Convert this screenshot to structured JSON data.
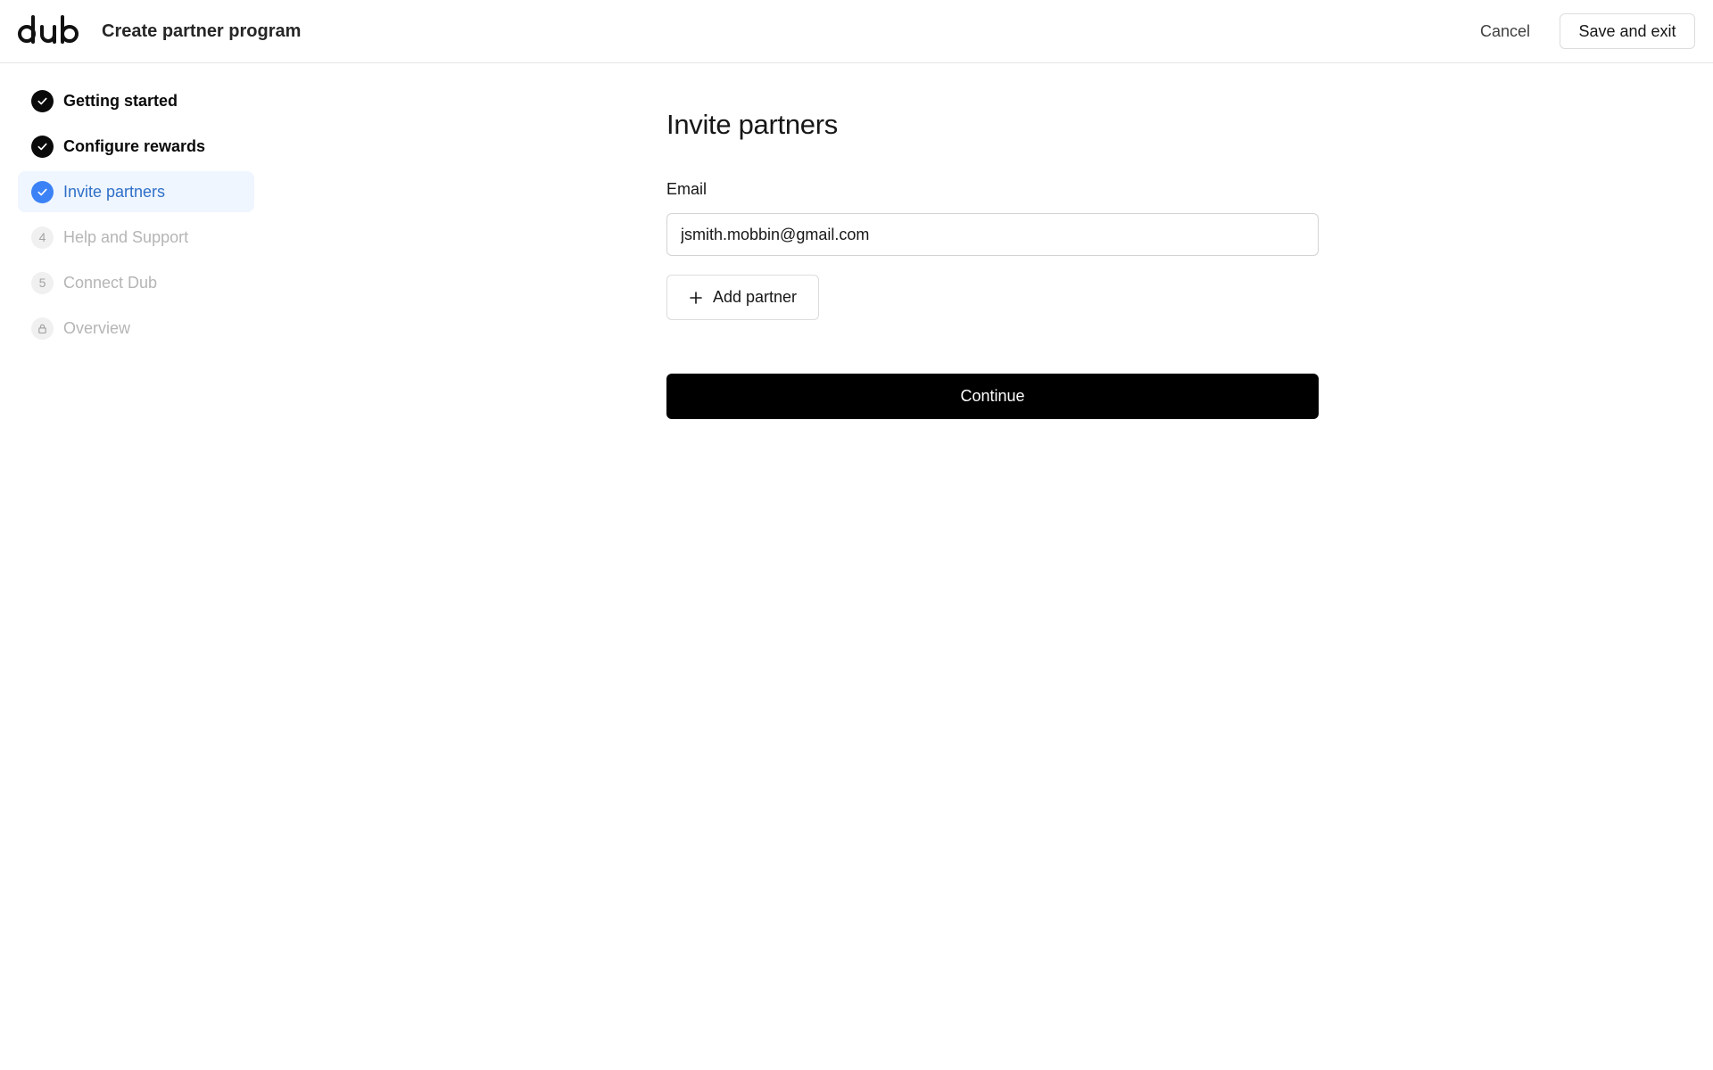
{
  "header": {
    "logo_text": "dub",
    "title": "Create partner program",
    "cancel_label": "Cancel",
    "save_label": "Save and exit"
  },
  "sidebar": {
    "steps": [
      {
        "label": "Getting started",
        "status": "completed",
        "icon": "check-icon"
      },
      {
        "label": "Configure rewards",
        "status": "completed",
        "icon": "check-icon"
      },
      {
        "label": "Invite partners",
        "status": "current",
        "icon": "check-icon"
      },
      {
        "label": "Help and Support",
        "status": "pending",
        "number": "4"
      },
      {
        "label": "Connect Dub",
        "status": "pending",
        "number": "5"
      },
      {
        "label": "Overview",
        "status": "locked",
        "icon": "lock-icon"
      }
    ]
  },
  "main": {
    "title": "Invite partners",
    "email_label": "Email",
    "email_value": "jsmith.mobbin@gmail.com",
    "add_partner_label": "Add partner",
    "continue_label": "Continue"
  },
  "colors": {
    "accent": "#3b82f6",
    "active_bg": "#eff6ff",
    "primary_button": "#000000"
  }
}
